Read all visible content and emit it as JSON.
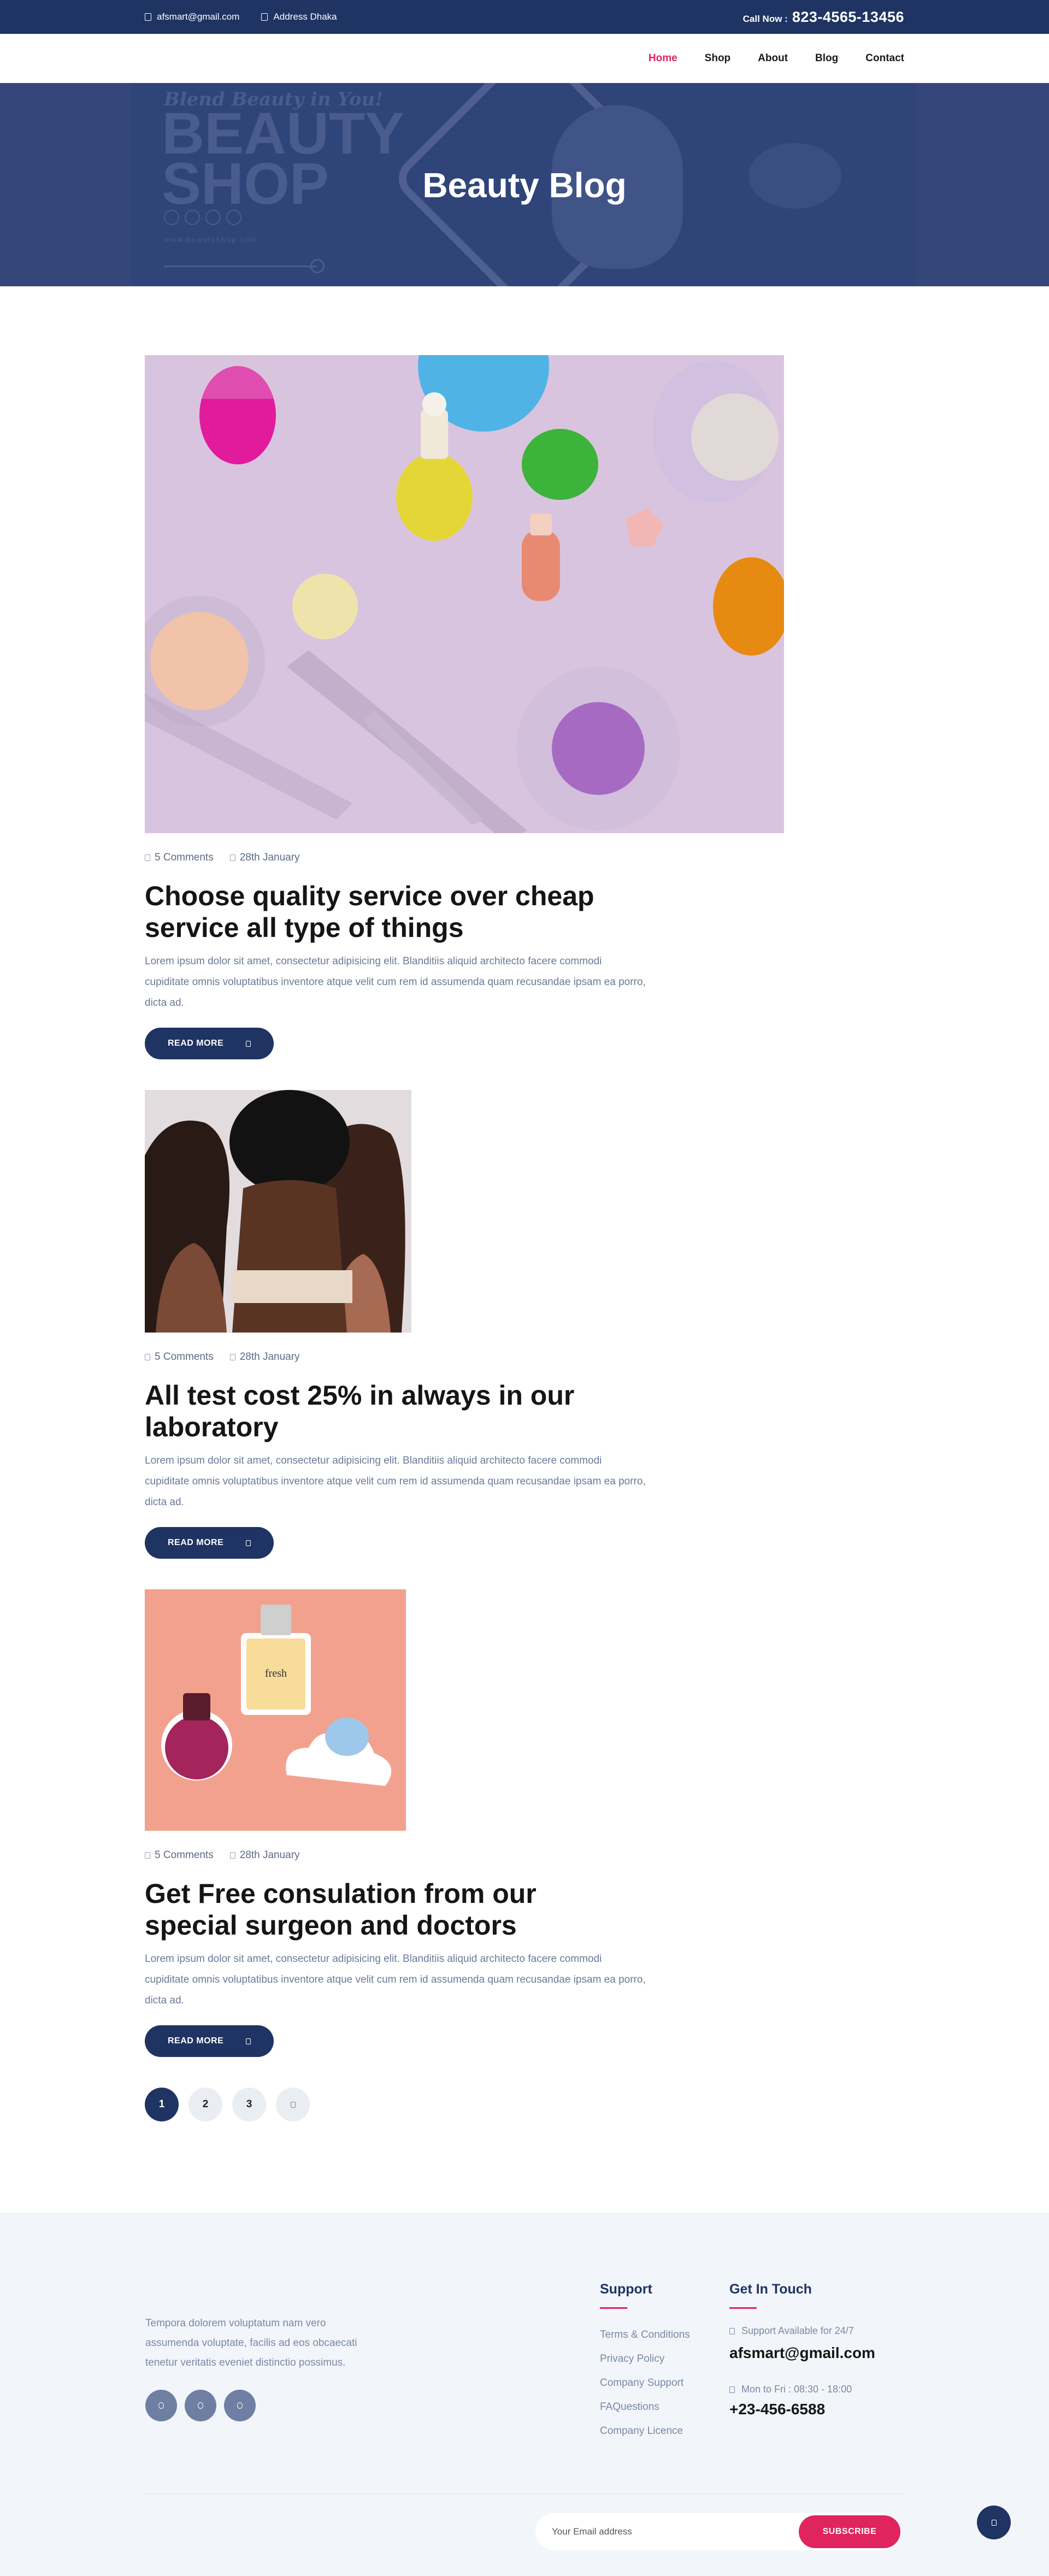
{
  "topbar": {
    "email": "afsmart@gmail.com",
    "address": "Address Dhaka",
    "call_label": "Call Now :",
    "call_number": "823-4565-13456"
  },
  "nav": {
    "items": [
      {
        "label": "Home"
      },
      {
        "label": "Shop"
      },
      {
        "label": "About"
      },
      {
        "label": "Blog"
      },
      {
        "label": "Contact"
      }
    ]
  },
  "banner": {
    "title": "Beauty Blog"
  },
  "posts": [
    {
      "comments": "5 Comments",
      "date": "28th January",
      "title": "Choose quality service over cheap service all type of things",
      "excerpt": "Lorem ipsum dolor sit amet, consectetur adipisicing elit. Blanditiis aliquid architecto facere commodi cupiditate omnis voluptatibus inventore atque velit cum rem id assumenda quam recusandae ipsam ea porro, dicta ad.",
      "button": "READ MORE"
    },
    {
      "comments": "5 Comments",
      "date": "28th January",
      "title": "All test cost 25% in always in our laboratory",
      "excerpt": "Lorem ipsum dolor sit amet, consectetur adipisicing elit. Blanditiis aliquid architecto facere commodi cupiditate omnis voluptatibus inventore atque velit cum rem id assumenda quam recusandae ipsam ea porro, dicta ad.",
      "button": "READ MORE"
    },
    {
      "comments": "5 Comments",
      "date": "28th January",
      "title": "Get Free consulation from our special surgeon and doctors",
      "excerpt": "Lorem ipsum dolor sit amet, consectetur adipisicing elit. Blanditiis aliquid architecto facere commodi cupiditate omnis voluptatibus inventore atque velit cum rem id assumenda quam recusandae ipsam ea porro, dicta ad.",
      "button": "READ MORE"
    }
  ],
  "pagination": {
    "pages": [
      "1",
      "2",
      "3"
    ],
    "active": "1"
  },
  "footer": {
    "about": "Tempora dolorem voluptatum nam vero assumenda voluptate, facilis ad eos obcaecati tenetur veritatis eveniet distinctio possimus.",
    "support": {
      "title": "Support",
      "links": [
        "Terms & Conditions",
        "Privacy Policy",
        "Company Support",
        "FAQuestions",
        "Company Licence"
      ]
    },
    "touch": {
      "title": "Get In Touch",
      "support_label": "Support Available for 24/7",
      "email": "afsmart@gmail.com",
      "hours_label": "Mon to Fri : 08:30 - 18:00",
      "phone": "+23-456-6588"
    },
    "subscribe": {
      "placeholder": "Your Email address",
      "button": "SUBSCRIBE"
    }
  },
  "colors": {
    "navy": "#1f3463",
    "accent": "#e0245e",
    "footer_bg": "#f2f6fa"
  },
  "background_art": {
    "banner_tagline": "Blend Beauty in You!",
    "banner_brand": "BEAUTY SHOP",
    "banner_url": "www.beautyshop.com"
  },
  "images": {
    "perfume_label": "fresh"
  }
}
